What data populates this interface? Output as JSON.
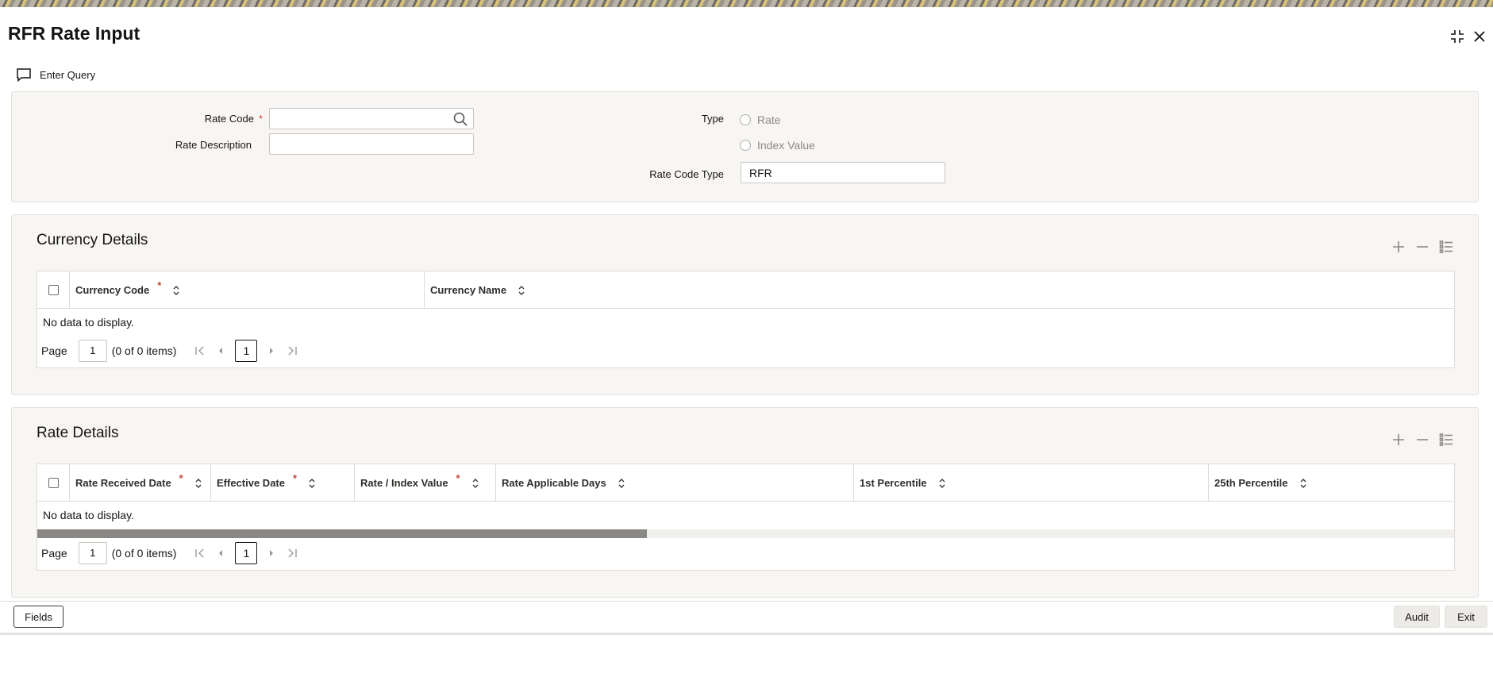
{
  "window": {
    "title": "RFR Rate Input",
    "controls": {
      "maximize_icon": "maximize-icon",
      "close_icon": "close-icon"
    }
  },
  "toolbar": {
    "enter_query_label": "Enter Query",
    "enter_query_icon": "speech-bubble-icon"
  },
  "header_form": {
    "rate_code_label": "Rate Code",
    "rate_code_value": "",
    "rate_description_label": "Rate Description",
    "rate_description_value": "",
    "type_label": "Type",
    "type_options": [
      "Rate",
      "Index Value"
    ],
    "type_selected": null,
    "rate_code_type_label": "Rate Code Type",
    "rate_code_type_value": "RFR"
  },
  "currency_details": {
    "title": "Currency Details",
    "columns": [
      "Currency Code",
      "Currency Name"
    ],
    "required_columns": [
      "Currency Code"
    ],
    "empty_text": "No data to display.",
    "pager": {
      "label": "Page",
      "page_input": "1",
      "count_text": "(0 of 0 items)",
      "current_page": "1"
    }
  },
  "rate_details": {
    "title": "Rate Details",
    "columns": [
      "Rate Received Date",
      "Effective Date",
      "Rate / Index Value",
      "Rate Applicable Days",
      "1st Percentile",
      "25th Percentile"
    ],
    "required_columns": [
      "Rate Received Date",
      "Effective Date",
      "Rate / Index Value"
    ],
    "empty_text": "No data to display.",
    "horizontal_scroll_fraction": 0.43,
    "pager": {
      "label": "Page",
      "page_input": "1",
      "count_text": "(0 of 0 items)",
      "current_page": "1"
    }
  },
  "footer": {
    "fields_label": "Fields",
    "audit_label": "Audit",
    "exit_label": "Exit"
  },
  "colors": {
    "required": "#c74634",
    "panel_bg": "#f7f6f4",
    "scroll_thumb": "#8a8884"
  }
}
